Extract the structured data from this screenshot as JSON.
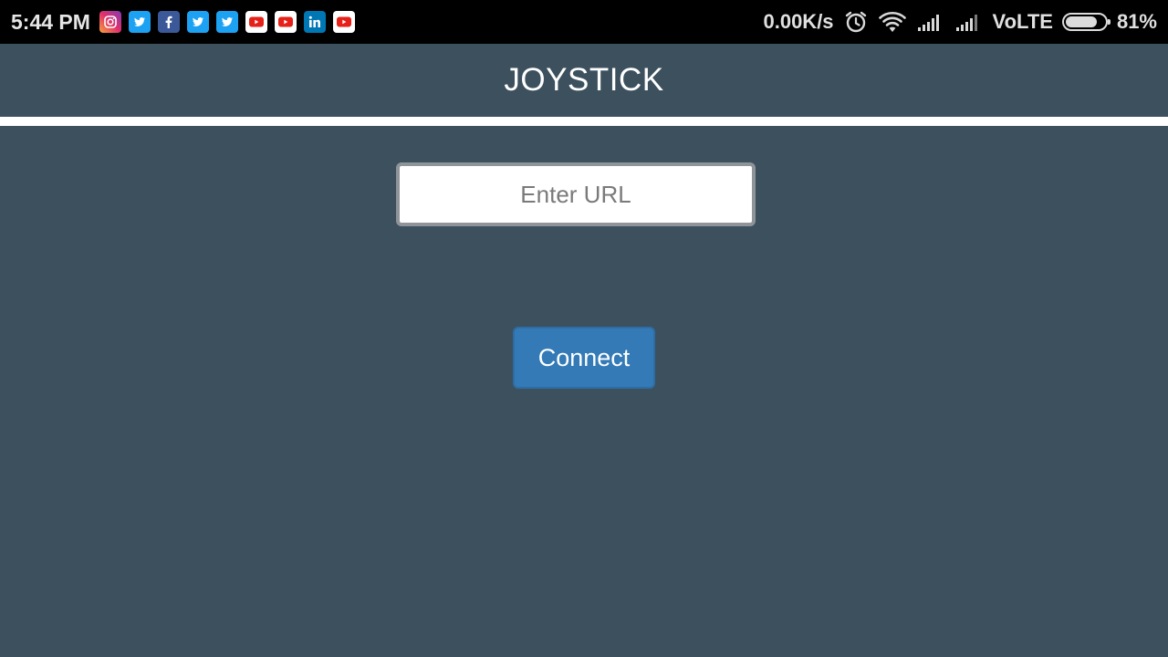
{
  "status_bar": {
    "time": "5:44 PM",
    "notification_icons": [
      {
        "name": "instagram-icon",
        "color": "#c13584"
      },
      {
        "name": "twitter-icon",
        "color": "#1da1f2"
      },
      {
        "name": "facebook-icon",
        "color": "#3b5998"
      },
      {
        "name": "twitter-icon",
        "color": "#1da1f2"
      },
      {
        "name": "twitter-icon",
        "color": "#1da1f2"
      },
      {
        "name": "youtube-icon",
        "color": "#e62117"
      },
      {
        "name": "youtube-icon",
        "color": "#e62117"
      },
      {
        "name": "linkedin-icon",
        "color": "#0077b5"
      },
      {
        "name": "youtube-icon",
        "color": "#e62117"
      }
    ],
    "network_speed": "0.00K/s",
    "network_type": "VoLTE",
    "battery_percent": "81%",
    "battery_level": 0.81
  },
  "app_bar": {
    "title": "JOYSTICK"
  },
  "url_input": {
    "value": "",
    "placeholder": "Enter URL"
  },
  "connect_button": {
    "label": "Connect"
  },
  "colors": {
    "background": "#3c505e",
    "status_bar": "#000000",
    "button": "#337ab7",
    "divider": "#ffffff"
  }
}
